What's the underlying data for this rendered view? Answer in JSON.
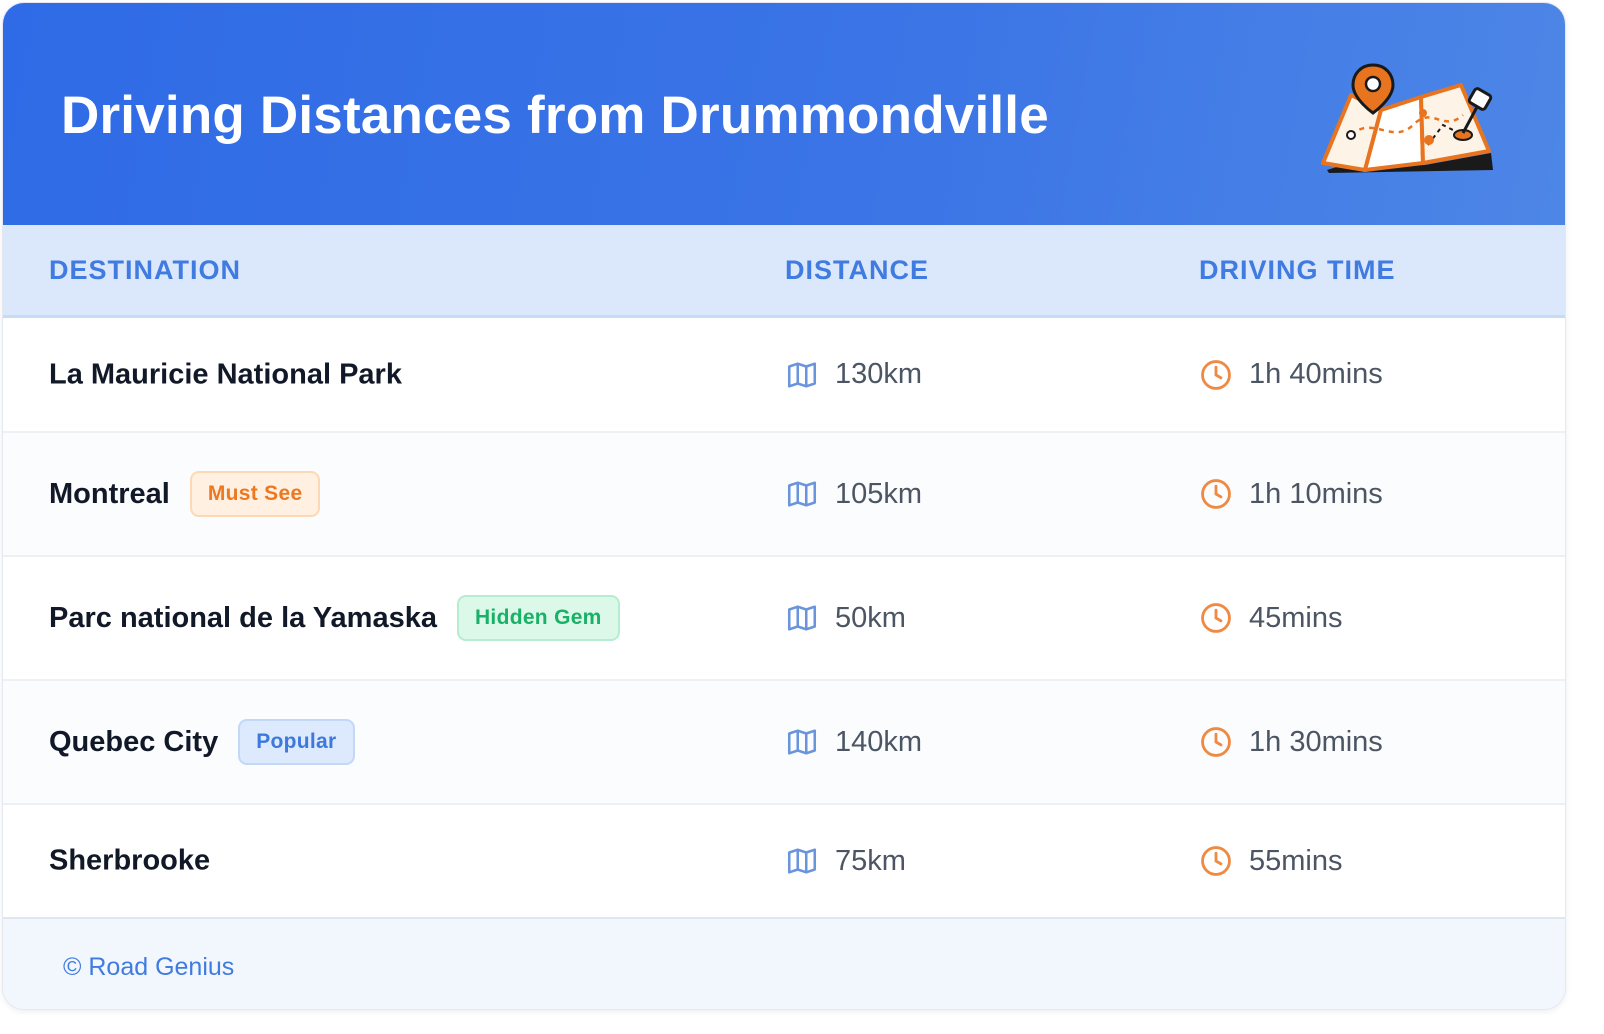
{
  "header": {
    "title": "Driving Distances from Drummondville",
    "illustration_icon": "folded-map-with-pins"
  },
  "columns": {
    "destination": "DESTINATION",
    "distance": "DISTANCE",
    "driving_time": "DRIVING TIME"
  },
  "icons": {
    "distance": "map-icon",
    "time": "clock-icon"
  },
  "rows": [
    {
      "destination": "La Mauricie National Park",
      "badge": "",
      "badge_color": "",
      "distance": "130km",
      "time": "1h 40mins"
    },
    {
      "destination": "Montreal",
      "badge": "Must See",
      "badge_color": "#ee7820",
      "distance": "105km",
      "time": "1h 10mins"
    },
    {
      "destination": "Parc national de la Yamaska",
      "badge": "Hidden Gem",
      "badge_color": "#19b168",
      "distance": "50km",
      "time": "45mins"
    },
    {
      "destination": "Quebec City",
      "badge": "Popular",
      "badge_color": "#3d79dd",
      "distance": "140km",
      "time": "1h 30mins"
    },
    {
      "destination": "Sherbrooke",
      "badge": "",
      "badge_color": "",
      "distance": "75km",
      "time": "55mins"
    }
  ],
  "footer": {
    "copyright": "© Road Genius"
  },
  "colors": {
    "header_blue": "#2f6be6",
    "accent_blue": "#3f7be0",
    "clock_orange": "#ef8a45",
    "map_icon_blue": "#6a95dc"
  }
}
